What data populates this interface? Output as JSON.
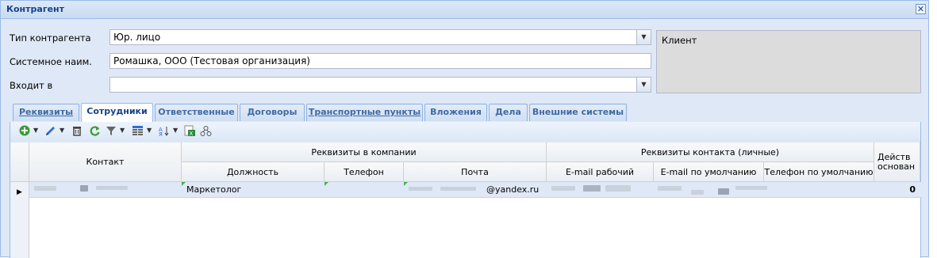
{
  "window": {
    "title": "Контрагент",
    "close_label": "✕"
  },
  "form": {
    "type_label": "Тип контрагента",
    "type_value": "Юр. лицо",
    "sysname_label": "Системное наим.",
    "sysname_value": "Ромашка, ООО (Тестовая организация)",
    "part_of_label": "Входит в",
    "part_of_value": "",
    "client_label": "Клиент"
  },
  "tabs": [
    {
      "label": "Реквизиты"
    },
    {
      "label": "Сотрудники"
    },
    {
      "label": "Ответственные"
    },
    {
      "label": "Договоры"
    },
    {
      "label": "Транспортные пункты"
    },
    {
      "label": "Вложения"
    },
    {
      "label": "Дела"
    },
    {
      "label": "Внешние системы"
    }
  ],
  "toolbar": {
    "icons": [
      "add-icon",
      "edit-icon",
      "delete-icon",
      "refresh-icon",
      "filter-icon",
      "columns-icon",
      "sort-icon",
      "export-excel-icon",
      "hierarchy-icon"
    ]
  },
  "grid": {
    "headers": {
      "contact": "Контакт",
      "company_group": "Реквизиты в компании",
      "position": "Должность",
      "phone": "Телефон",
      "mail": "Почта",
      "personal_group": "Реквизиты контакта (личные)",
      "email_work": "E-mail рабочий",
      "email_default": "E-mail по умолчанию",
      "phone_default": "Телефон по умолчанию",
      "acting_basis": "Действ основан"
    },
    "rows": [
      {
        "position": "Маркетолог",
        "mail": "@yandex.ru",
        "acting": "0"
      }
    ]
  }
}
